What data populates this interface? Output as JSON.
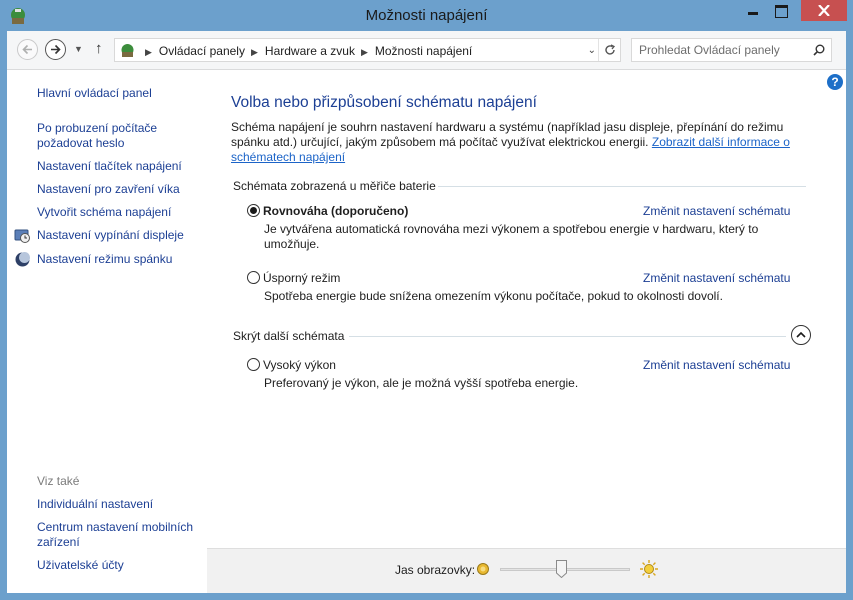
{
  "window": {
    "title": "Možnosti napájení"
  },
  "address_bar": {
    "crumbs": [
      "Ovládací panely",
      "Hardware a zvuk",
      "Možnosti napájení"
    ],
    "search_placeholder": "Prohledat Ovládací panely"
  },
  "sidebar": {
    "links": [
      "Hlavní ovládací panel",
      "Po probuzení počítače požadovat heslo",
      "Nastavení tlačítek napájení",
      "Nastavení pro zavření víka",
      "Vytvořit schéma napájení",
      "Nastavení vypínání displeje",
      "Nastavení režimu spánku"
    ],
    "link_lines": {
      "wake_password_1": "Po probuzení počítače",
      "wake_password_2": "požadovat heslo"
    },
    "see_also_title": "Viz také",
    "see_also": {
      "individual": "Individuální nastavení",
      "mobility_1": "Centrum nastavení mobilních",
      "mobility_2": "zařízení",
      "accounts": "Uživatelské účty"
    }
  },
  "main": {
    "title": "Volba nebo přizpůsobení schématu napájení",
    "intro": "Schéma napájení je souhrn nastavení hardwaru a systému (například jasu displeje, přepínání do režimu spánku atd.) určující, jakým způsobem má počítač využívat elektrickou energii.",
    "intro_link": "Zobrazit další informace o schématech napájení",
    "group_battery": "Schémata zobrazená u měřiče baterie",
    "group_hidden": "Skrýt další schémata",
    "change_label": "Změnit nastavení schématu",
    "plans": {
      "balanced": {
        "name": "Rovnováha (doporučeno)",
        "desc": "Je vytvářena automatická rovnováha mezi výkonem a spotřebou energie v hardwaru, který to umožňuje.",
        "selected": true
      },
      "saver": {
        "name": "Úsporný režim",
        "desc": "Spotřeba energie bude snížena omezením výkonu počítače, pokud to okolnosti dovolí.",
        "selected": false
      },
      "high": {
        "name": "Vysoký výkon",
        "desc": "Preferovaný je výkon, ale je možná vyšší spotřeba energie.",
        "selected": false
      }
    }
  },
  "brightness": {
    "label": "Jas obrazovky:",
    "level": 0.47
  },
  "colors": {
    "link": "#1c3f94",
    "frame": "#6ca0cc",
    "close": "#c75050"
  }
}
